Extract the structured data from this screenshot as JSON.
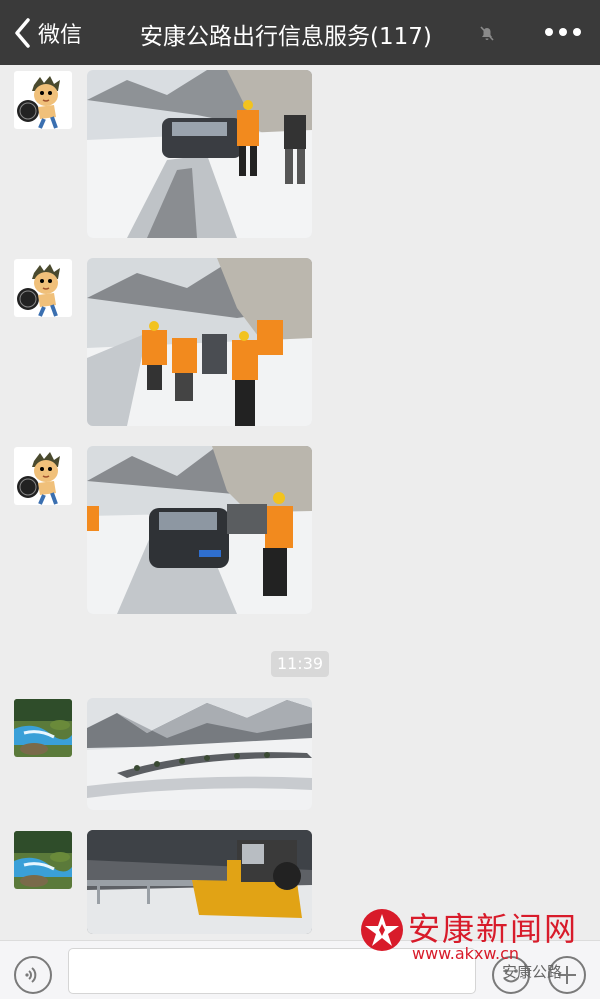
{
  "header": {
    "back_label": "微信",
    "title": "安康公路出行信息服务(117)",
    "back_icon": "chevron-left-icon",
    "mute_icon": "bell-off-icon",
    "more_icon": "more-dots-icon"
  },
  "chat": {
    "timestamp": "11:39",
    "messages": [
      {
        "sender_avatar": "cartoon-character-avatar",
        "content": "snowy road rescue photo"
      },
      {
        "sender_avatar": "cartoon-character-avatar",
        "content": "workers pushing car photo"
      },
      {
        "sender_avatar": "cartoon-character-avatar",
        "content": "car on snowy road photo"
      },
      {
        "sender_avatar": "river-landscape-avatar",
        "content": "snowy mountain curve photo"
      },
      {
        "sender_avatar": "river-landscape-avatar",
        "content": "snow plow loader photo"
      }
    ]
  },
  "input_bar": {
    "voice_icon": "voice-icon",
    "emoji_icon": "emoji-icon",
    "plus_icon": "plus-icon"
  },
  "watermark": {
    "site_name": "安康新闻网",
    "url": "www.akxw.cn",
    "brand": "安康公路"
  },
  "colors": {
    "header_bg": "#3a3a3a",
    "chat_bg": "#ededed",
    "watermark_red": "#d81b2a"
  }
}
